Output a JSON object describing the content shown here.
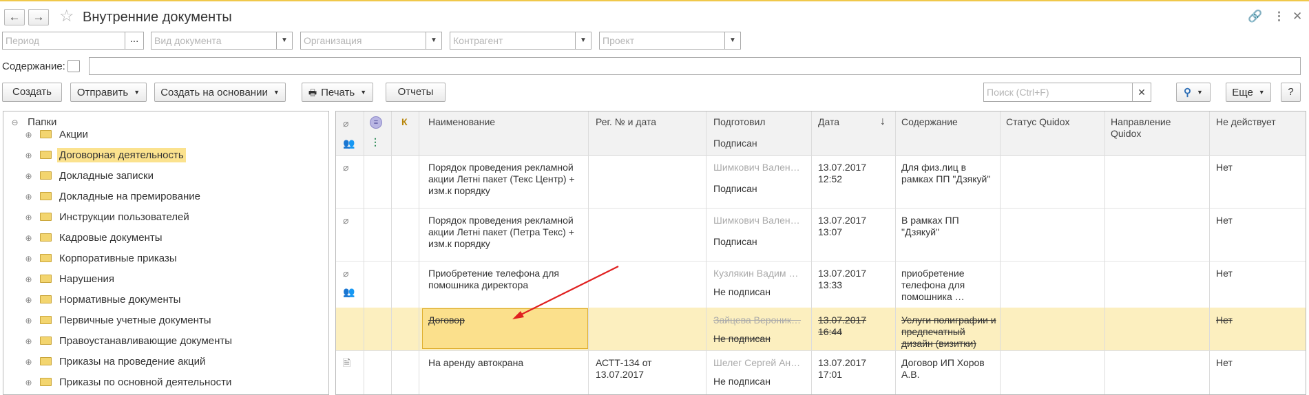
{
  "window": {
    "title": "Внутренние документы",
    "back_icon": "←",
    "forward_icon": "→",
    "star_icon": "☆",
    "link_icon": "🔗",
    "more_icon": "⋮",
    "close_icon": "✕"
  },
  "filters": {
    "period_placeholder": "Период",
    "period_button": "...",
    "doc_kind_placeholder": "Вид документа",
    "organization_placeholder": "Организация",
    "counterparty_placeholder": "Контрагент",
    "project_placeholder": "Проект"
  },
  "content_filter": {
    "label": "Содержание:"
  },
  "toolbar": {
    "create": "Создать",
    "send": "Отправить",
    "create_based": "Создать на основании",
    "print": "Печать",
    "reports": "Отчеты",
    "search_placeholder": "Поиск (Ctrl+F)",
    "more": "Еще",
    "help": "?"
  },
  "tree": {
    "root": "Папки",
    "items": [
      {
        "label": "Акции"
      },
      {
        "label": "Договорная деятельность"
      },
      {
        "label": "Докладные записки"
      },
      {
        "label": "Докладные на премирование"
      },
      {
        "label": "Инструкции пользователей"
      },
      {
        "label": "Кадровые документы"
      },
      {
        "label": "Корпоративные приказы"
      },
      {
        "label": "Нарушения"
      },
      {
        "label": "Нормативные документы"
      },
      {
        "label": "Первичные учетные документы"
      },
      {
        "label": "Правоустанавливающие документы"
      },
      {
        "label": "Приказы на проведение акций"
      },
      {
        "label": "Приказы по основной деятельности"
      }
    ]
  },
  "grid": {
    "columns": {
      "k": "К",
      "name": "Наименование",
      "reg": "Рег. № и дата",
      "prepared": "Подготовил",
      "signed": "Подписан",
      "date": "Дата",
      "sort_icon": "↓",
      "content": "Содержание",
      "quidox_status": "Статус Quidox",
      "quidox_direction": "Направление Quidox",
      "inactive": "Не действует"
    },
    "rows": [
      {
        "name": "Порядок проведения рекламной акции Летні пакет (Текс Центр) + изм.к порядку",
        "reg": "",
        "prepared": "Шимкович Вален…",
        "signed": "Подписан",
        "date": "13.07.2017",
        "time": "12:52",
        "content": "Для физ.лиц в рамках ПП \"Дзякуй\"",
        "inactive": "Нет"
      },
      {
        "name": "Порядок проведения рекламной акции Летні пакет (Петра Текс) + изм.к порядку",
        "reg": "",
        "prepared": "Шимкович Вален…",
        "signed": "Подписан",
        "date": "13.07.2017",
        "time": "13:07",
        "content": "В рамках ПП \"Дзякуй\"",
        "inactive": "Нет"
      },
      {
        "name": "Приобретение телефона для помошника директора",
        "reg": "",
        "prepared": "Кузлякин Вадим …",
        "signed": "Не подписан",
        "date": "13.07.2017",
        "time": "13:33",
        "content": "приобретение телефона для помошника …",
        "inactive": "Нет"
      },
      {
        "name": "Договор",
        "reg": "",
        "prepared": "Зайцева Вероник…",
        "signed": "Не подписан",
        "date": "13.07.2017",
        "time": "16:44",
        "content": "Услуги полиграфии и предпечатный дизайн (визитки)",
        "inactive": "Нет"
      },
      {
        "name": "На аренду автокрана",
        "reg": "АСТТ-134 от 13.07.2017",
        "prepared": "Шелег Сергей Ан…",
        "signed": "Не подписан",
        "date": "13.07.2017",
        "time": "17:01",
        "content": "Договор ИП Хоров А.В.",
        "inactive": "Нет"
      }
    ]
  },
  "colors": {
    "accent": "#f0c84a",
    "selected_row": "#fcefbf",
    "selected_cell": "#fbe08c",
    "arrow": "#e02020"
  }
}
